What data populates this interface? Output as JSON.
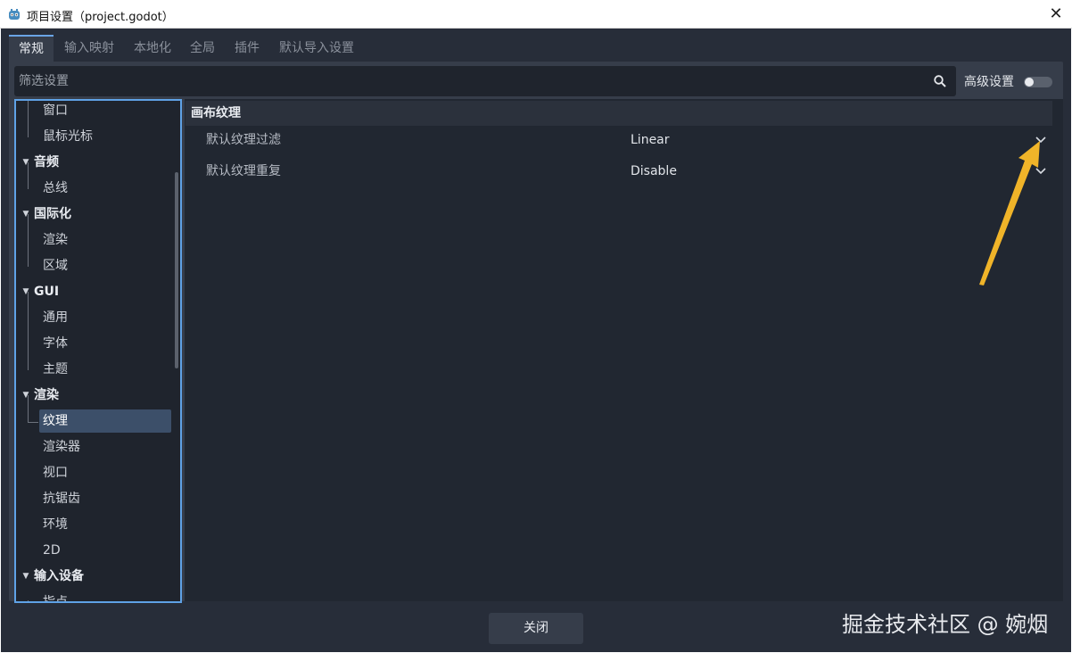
{
  "window": {
    "title": "项目设置（project.godot）",
    "close_glyph": "✕"
  },
  "tabs": [
    {
      "label": "常规",
      "active": true
    },
    {
      "label": "输入映射",
      "active": false
    },
    {
      "label": "本地化",
      "active": false
    },
    {
      "label": "全局",
      "active": false
    },
    {
      "label": "插件",
      "active": false
    },
    {
      "label": "默认导入设置",
      "active": false
    }
  ],
  "search": {
    "placeholder": "筛选设置",
    "value": "",
    "icon": "search-icon"
  },
  "advanced": {
    "label": "高级设置",
    "enabled": false
  },
  "tree": {
    "items": [
      {
        "label": "窗口",
        "kind": "child"
      },
      {
        "label": "鼠标光标",
        "kind": "child"
      },
      {
        "label": "音频",
        "kind": "category"
      },
      {
        "label": "总线",
        "kind": "child"
      },
      {
        "label": "国际化",
        "kind": "category"
      },
      {
        "label": "渲染",
        "kind": "child"
      },
      {
        "label": "区域",
        "kind": "child"
      },
      {
        "label": "GUI",
        "kind": "category"
      },
      {
        "label": "通用",
        "kind": "child"
      },
      {
        "label": "字体",
        "kind": "child"
      },
      {
        "label": "主题",
        "kind": "child"
      },
      {
        "label": "渲染",
        "kind": "category"
      },
      {
        "label": "纹理",
        "kind": "child",
        "selected": true
      },
      {
        "label": "渲染器",
        "kind": "child"
      },
      {
        "label": "视口",
        "kind": "child"
      },
      {
        "label": "抗锯齿",
        "kind": "child"
      },
      {
        "label": "环境",
        "kind": "child"
      },
      {
        "label": "2D",
        "kind": "child"
      },
      {
        "label": "输入设备",
        "kind": "category"
      },
      {
        "label": "指点",
        "kind": "child"
      }
    ]
  },
  "inspector": {
    "section_title": "画布纹理",
    "properties": [
      {
        "label": "默认纹理过滤",
        "value": "Linear"
      },
      {
        "label": "默认纹理重复",
        "value": "Disable"
      }
    ]
  },
  "footer": {
    "close_label": "关闭"
  },
  "watermark": "掘金技术社区 @ 婉烟",
  "colors": {
    "background": "#272d39",
    "panel": "#363d4a",
    "field": "#1f242d",
    "accent": "#5fa2e6",
    "selection": "#3c4f69",
    "arrow": "#f0b429"
  }
}
